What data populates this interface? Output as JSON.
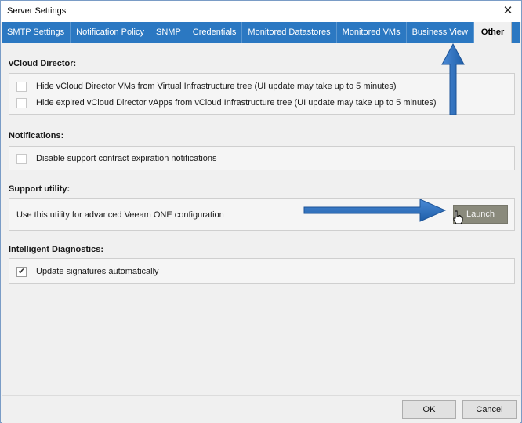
{
  "window": {
    "title": "Server Settings"
  },
  "tabs": [
    {
      "label": "SMTP Settings",
      "active": false
    },
    {
      "label": "Notification Policy",
      "active": false
    },
    {
      "label": "SNMP",
      "active": false
    },
    {
      "label": "Credentials",
      "active": false
    },
    {
      "label": "Monitored Datastores",
      "active": false
    },
    {
      "label": "Monitored VMs",
      "active": false
    },
    {
      "label": "Business View",
      "active": false
    },
    {
      "label": "Other",
      "active": true
    }
  ],
  "vcloud": {
    "title": "vCloud Director:",
    "options": [
      {
        "label": "Hide vCloud Director VMs from Virtual Infrastructure tree (UI update may take up to 5 minutes)",
        "checked": false
      },
      {
        "label": "Hide expired vCloud Director vApps from vCloud Infrastructure tree (UI update may take up to 5 minutes)",
        "checked": false
      }
    ]
  },
  "notifications": {
    "title": "Notifications:",
    "options": [
      {
        "label": "Disable support contract expiration notifications",
        "checked": false
      }
    ]
  },
  "support": {
    "title": "Support utility:",
    "description": "Use this utility for advanced Veeam ONE configuration",
    "launch_label": "Launch"
  },
  "diagnostics": {
    "title": "Intelligent Diagnostics:",
    "options": [
      {
        "label": "Update signatures automatically",
        "checked": true
      }
    ]
  },
  "footer": {
    "ok_label": "OK",
    "cancel_label": "Cancel"
  },
  "colors": {
    "tab_strip": "#2b78c2",
    "annotation_arrow": "#2e6db5",
    "launch_button": "#8a8a7c"
  }
}
